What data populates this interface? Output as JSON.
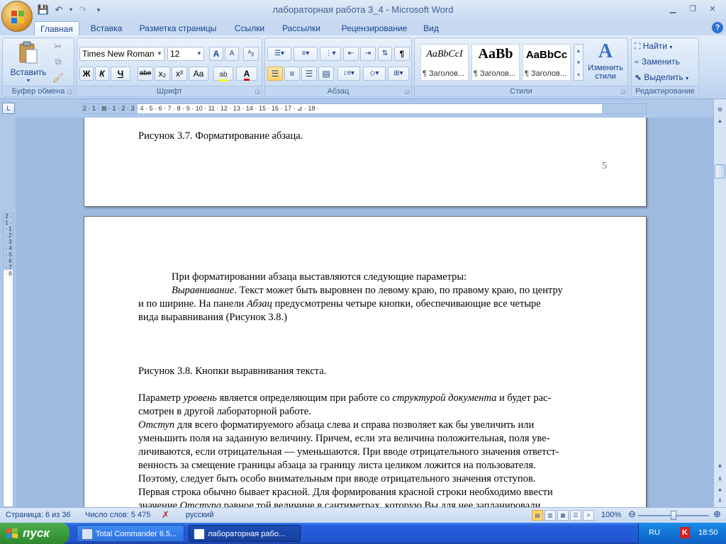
{
  "window": {
    "title": "лабораторная работа 3_4 - Microsoft Word"
  },
  "tabs": [
    "Главная",
    "Вставка",
    "Разметка страницы",
    "Ссылки",
    "Рассылки",
    "Рецензирование",
    "Вид"
  ],
  "ribbon": {
    "clipboard": {
      "label": "Буфер обмена",
      "paste": "Вставить"
    },
    "font": {
      "label": "Шрифт",
      "family": "Times New Roman",
      "size": "12",
      "bold": "Ж",
      "italic": "К",
      "underline": "Ч",
      "strike": "abe",
      "subscript": "x₂",
      "superscript": "x²",
      "change_case": "Aa",
      "grow": "A",
      "shrink": "A"
    },
    "paragraph": {
      "label": "Абзац",
      "pilcrow": "¶"
    },
    "styles": {
      "label": "Стили",
      "tiles": [
        {
          "sample": "AaBbCcI",
          "name": "¶ Заголов..."
        },
        {
          "sample": "AaBb",
          "name": "¶ Заголов..."
        },
        {
          "sample": "AaBbCc",
          "name": "¶ Заголов..."
        }
      ],
      "change_styles": "Изменить стили"
    },
    "editing": {
      "label": "Редактирование",
      "find": "Найти",
      "replace": "Заменить",
      "select": "Выделить"
    }
  },
  "ruler": {
    "marks": "2 · 1 · ⊠ · 1 · 2 · 3 · 4 · 5 · 6 · 7 · 8 · 9 · 10 · 11 · 12 · 13 · 14 · 15 · 16 · 17 · ⊿ · 18 ·"
  },
  "vruler": {
    "marks": "2 · 1 · · 1 · 2 · 3 · 4 · 5 · 6 · 7 · 8"
  },
  "page1": {
    "caption": "Рисунок 3.7. Форматирование абзаца.",
    "page_number": "5"
  },
  "page2": {
    "lines": [
      {
        "indent": true,
        "runs": [
          {
            "t": "При форматировании абзаца выставляются следующие параметры:"
          }
        ]
      },
      {
        "indent": true,
        "runs": [
          {
            "t": "Выравнивание",
            "i": true
          },
          {
            "t": ". Текст может быть выровнен по левому краю, по правому краю, по центру"
          }
        ]
      },
      {
        "runs": [
          {
            "t": "и по ширине. На панели "
          },
          {
            "t": "Абзац",
            "i": true
          },
          {
            "t": " предусмотрены четыре кнопки, обеспечивающие все четыре"
          }
        ]
      },
      {
        "runs": [
          {
            "t": "вида выравнивания (Рисунок 3.8.)"
          }
        ]
      },
      {
        "gap": 3,
        "runs": [
          {
            "t": "Рисунок 3.8. Кнопки выравнивания текста."
          }
        ]
      },
      {
        "gap": 1,
        "runs": [
          {
            "t": "Параметр "
          },
          {
            "t": "уровень",
            "i": true
          },
          {
            "t": " является определяющим при работе со "
          },
          {
            "t": "структурой документа",
            "i": true
          },
          {
            "t": " и будет рас-"
          }
        ]
      },
      {
        "runs": [
          {
            "t": "смотрен в другой лабораторной работе."
          }
        ]
      },
      {
        "runs": [
          {
            "t": "Отступ",
            "i": true
          },
          {
            "t": " для всего форматируемого абзаца слева и  справа позволяет как бы увеличить или"
          }
        ]
      },
      {
        "runs": [
          {
            "t": "уменьшить поля на заданную величину. Причем, если эта величина положительная, поля уве-"
          }
        ]
      },
      {
        "runs": [
          {
            "t": "личиваются, если отрицательная — уменьшаются. При вводе отрицательного значения ответст-"
          }
        ]
      },
      {
        "runs": [
          {
            "t": "венность за смещение границы абзаца за границу листа целиком ложится на пользователя."
          }
        ]
      },
      {
        "runs": [
          {
            "t": "Поэтому, следует быть особо внимательным при вводе отрицательного значения отступов."
          }
        ]
      },
      {
        "runs": [
          {
            "t": "Первая строка обычно бывает красной. Для формирования красной строки необходимо ввести"
          }
        ]
      },
      {
        "runs": [
          {
            "t": "значение "
          },
          {
            "t": "Отступа",
            "i": true
          },
          {
            "t": " равное той величине в сантиметрах, которую Вы для нее запланировали."
          }
        ]
      }
    ]
  },
  "status": {
    "page": "Страница: 6 из 36",
    "words": "Число слов: 5 475",
    "language": "русский",
    "zoom": "100%",
    "zoom_level": 1.0
  },
  "taskbar": {
    "start": "пуск",
    "tasks": [
      "Total Commander 6.5...",
      "лабораторная рабо..."
    ],
    "lang": "RU",
    "time": "18:50"
  },
  "colors": {
    "ribbon_text": "#15428b",
    "doc_background": "#9ebadf",
    "taskbar": "#245edb",
    "start_button": "#3a9b3a"
  }
}
